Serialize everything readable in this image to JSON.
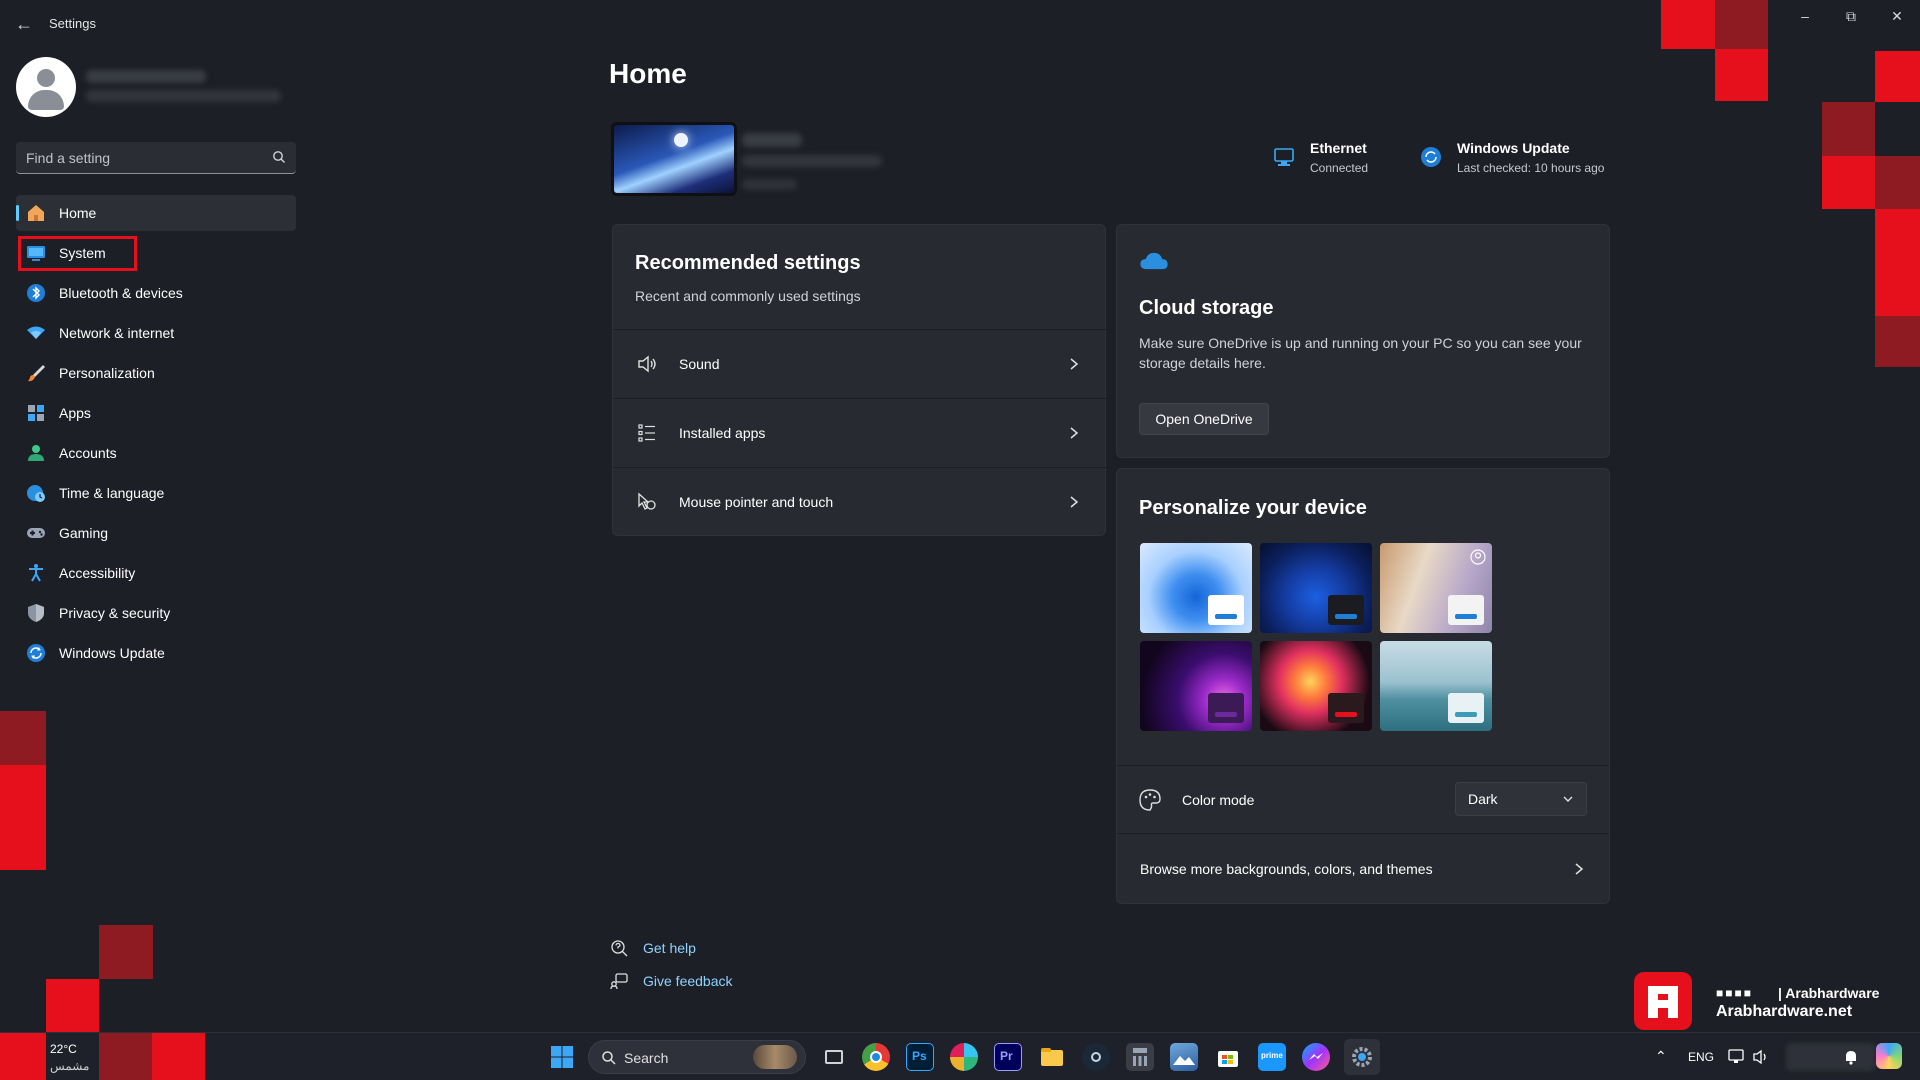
{
  "window": {
    "title": "Settings"
  },
  "sidebar": {
    "search_placeholder": "Find a setting",
    "items": [
      {
        "label": "Home",
        "icon": "home-icon"
      },
      {
        "label": "System",
        "icon": "monitor-icon"
      },
      {
        "label": "Bluetooth & devices",
        "icon": "bluetooth-icon"
      },
      {
        "label": "Network & internet",
        "icon": "wifi-icon"
      },
      {
        "label": "Personalization",
        "icon": "brush-icon"
      },
      {
        "label": "Apps",
        "icon": "apps-icon"
      },
      {
        "label": "Accounts",
        "icon": "person-icon"
      },
      {
        "label": "Time & language",
        "icon": "globe-clock-icon"
      },
      {
        "label": "Gaming",
        "icon": "gamepad-icon"
      },
      {
        "label": "Accessibility",
        "icon": "accessibility-icon"
      },
      {
        "label": "Privacy & security",
        "icon": "shield-icon"
      },
      {
        "label": "Windows Update",
        "icon": "update-icon"
      }
    ],
    "active_index": 0,
    "highlighted_index": 1
  },
  "main": {
    "title": "Home",
    "status": {
      "ethernet": {
        "title": "Ethernet",
        "subtitle": "Connected"
      },
      "update": {
        "title": "Windows Update",
        "subtitle": "Last checked: 10 hours ago"
      }
    },
    "recommended": {
      "title": "Recommended settings",
      "subtitle": "Recent and commonly used settings",
      "items": [
        {
          "label": "Sound",
          "icon": "speaker-icon"
        },
        {
          "label": "Installed apps",
          "icon": "list-icon"
        },
        {
          "label": "Mouse pointer and touch",
          "icon": "mouse-pointer-icon"
        }
      ]
    },
    "cloud": {
      "title": "Cloud storage",
      "description": "Make sure OneDrive is up and running on your PC so you can see your storage details here.",
      "button": "Open OneDrive"
    },
    "personalize": {
      "title": "Personalize your device",
      "color_mode_label": "Color mode",
      "color_mode_value": "Dark",
      "browse_label": "Browse more backgrounds, colors, and themes"
    },
    "help": {
      "get_help": "Get help",
      "give_feedback": "Give feedback"
    }
  },
  "taskbar": {
    "weather_temp": "22°C",
    "weather_desc": "مشمس",
    "search_label": "Search",
    "language": "ENG"
  },
  "watermark": {
    "handle": "| Arabhardware",
    "site": "Arabhardware.net"
  },
  "colors": {
    "accent": "#60cdff",
    "highlight_red": "#e5101b",
    "background": "#1c1f26",
    "card": "#272a31"
  }
}
